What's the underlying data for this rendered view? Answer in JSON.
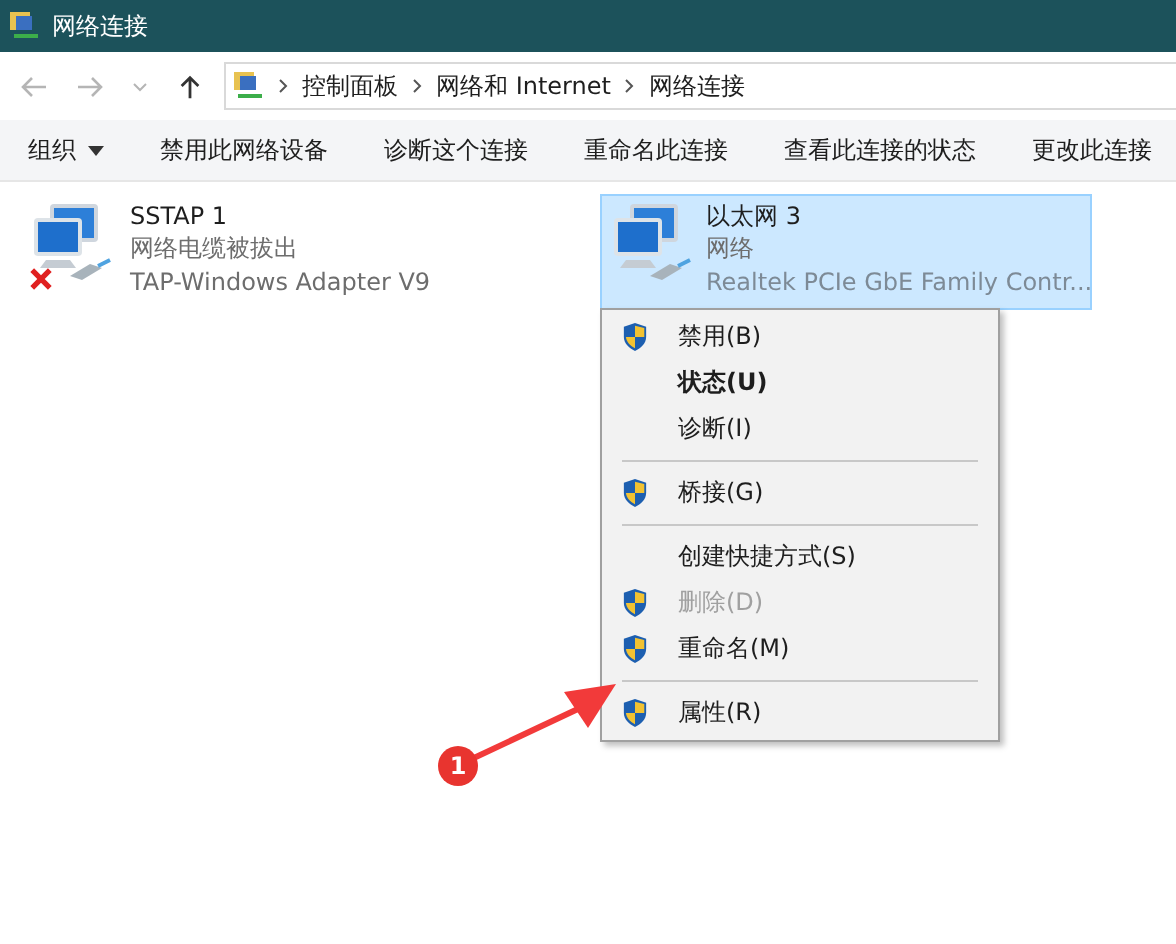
{
  "window": {
    "title": "网络连接"
  },
  "address_bar": {
    "breadcrumbs": [
      "控制面板",
      "网络和 Internet",
      "网络连接"
    ]
  },
  "toolbar": {
    "buttons": [
      {
        "label": "组织",
        "dropdown": true
      },
      {
        "label": "禁用此网络设备",
        "dropdown": false
      },
      {
        "label": "诊断这个连接",
        "dropdown": false
      },
      {
        "label": "重命名此连接",
        "dropdown": false
      },
      {
        "label": "查看此连接的状态",
        "dropdown": false
      },
      {
        "label": "更改此连接",
        "dropdown": false
      }
    ]
  },
  "connections": [
    {
      "name": "SSTAP 1",
      "status": "网络电缆被拔出",
      "adapter": "TAP-Windows Adapter V9",
      "disconnected": true,
      "selected": false
    },
    {
      "name": "以太网 3",
      "status": "网络",
      "adapter": "Realtek PCIe GbE Family Contr...",
      "disconnected": false,
      "selected": true
    }
  ],
  "context_menu": {
    "items": [
      {
        "kind": "item",
        "label": "禁用(B)",
        "shield": true,
        "bold": false,
        "disabled": false
      },
      {
        "kind": "item",
        "label": "状态(U)",
        "shield": false,
        "bold": true,
        "disabled": false
      },
      {
        "kind": "item",
        "label": "诊断(I)",
        "shield": false,
        "bold": false,
        "disabled": false
      },
      {
        "kind": "separator"
      },
      {
        "kind": "item",
        "label": "桥接(G)",
        "shield": true,
        "bold": false,
        "disabled": false
      },
      {
        "kind": "separator"
      },
      {
        "kind": "item",
        "label": "创建快捷方式(S)",
        "shield": false,
        "bold": false,
        "disabled": false
      },
      {
        "kind": "item",
        "label": "删除(D)",
        "shield": true,
        "bold": false,
        "disabled": true
      },
      {
        "kind": "item",
        "label": "重命名(M)",
        "shield": true,
        "bold": false,
        "disabled": false
      },
      {
        "kind": "separator"
      },
      {
        "kind": "item",
        "label": "属性(R)",
        "shield": true,
        "bold": false,
        "disabled": false
      }
    ]
  },
  "annotation": {
    "number": "1"
  }
}
